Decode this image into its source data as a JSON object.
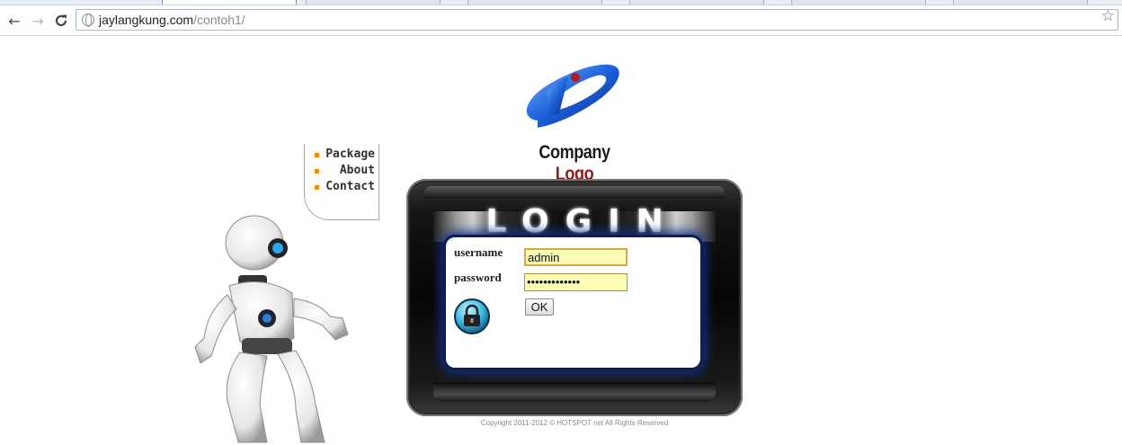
{
  "browser": {
    "url_host": "jaylangkung.com",
    "url_path": "/contoh1/",
    "icons": {
      "back": "back-arrow-icon",
      "forward": "forward-arrow-icon",
      "reload": "reload-icon",
      "site": "globe-icon",
      "bookmark": "star-icon"
    }
  },
  "logo": {
    "text_main": "Company",
    "text_accent": "Logo",
    "accent_color": "#8e1c1c"
  },
  "menu": {
    "items": [
      {
        "label": "Package"
      },
      {
        "label": "About"
      },
      {
        "label": "Contact"
      }
    ],
    "bullet_color": "#f08a00"
  },
  "login": {
    "title": "LOGIN",
    "username_label": "username",
    "password_label": "password",
    "username_value": "admin",
    "password_value": "•••••••••••••",
    "ok_label": "OK",
    "field_color": "#fdfdb6",
    "screen_glow": "#12308a"
  },
  "footer": {
    "copyright": "Copyright 2011-2012 © HOTSPOT net All Rights Reserved"
  }
}
